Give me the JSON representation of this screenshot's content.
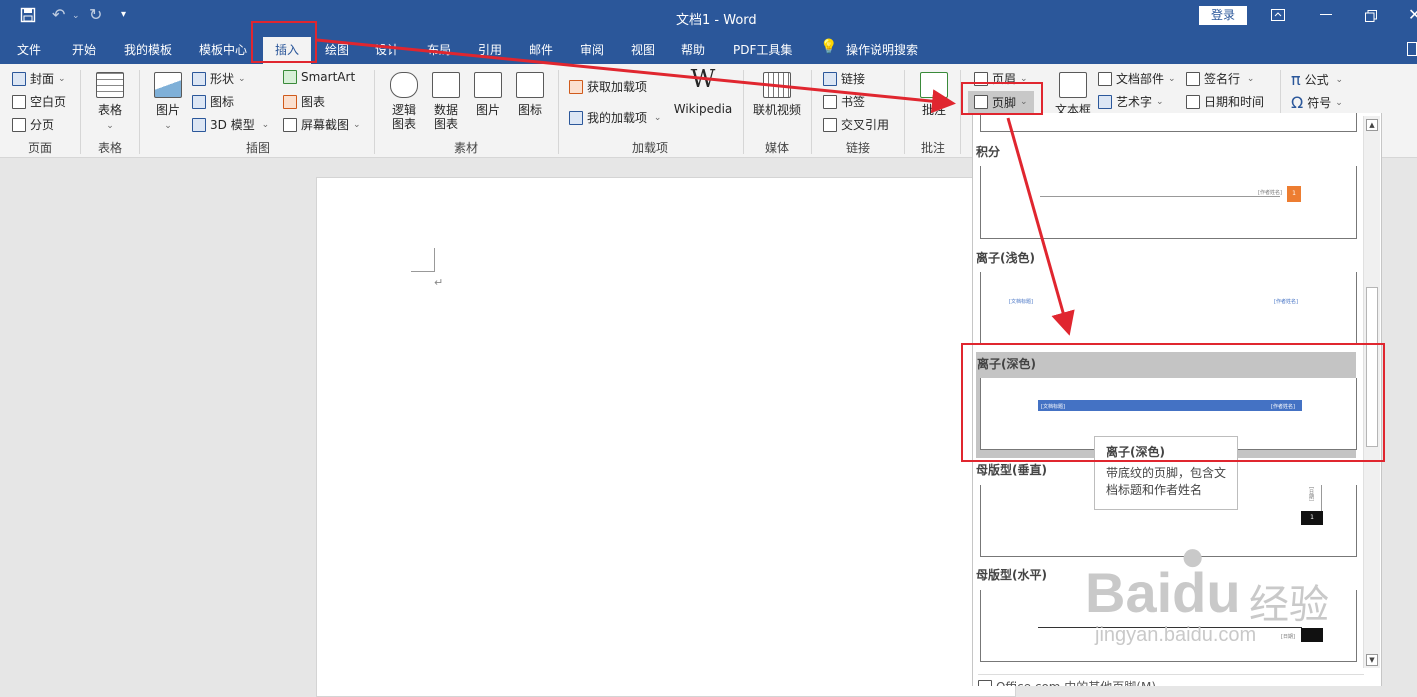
{
  "titlebar": {
    "doc_title": "文档1  -  Word",
    "login_label": "登录"
  },
  "tabs": [
    "文件",
    "开始",
    "我的模板",
    "模板中心",
    "插入",
    "绘图",
    "设计",
    "布局",
    "引用",
    "邮件",
    "审阅",
    "视图",
    "帮助",
    "PDF工具集"
  ],
  "tell_me": "操作说明搜索",
  "ribbon": {
    "pages": {
      "cover": "封面",
      "blank": "空白页",
      "break": "分页",
      "group": "页面"
    },
    "tables": {
      "table": "表格",
      "group": "表格"
    },
    "illustrations": {
      "picture": "图片",
      "shapes": "形状",
      "icons": "图标",
      "model3d": "3D 模型",
      "smartart": "SmartArt",
      "chart": "图表",
      "screenshot": "屏幕截图",
      "group": "插图"
    },
    "materials": {
      "logic1": "逻辑",
      "logic2": "图表",
      "data1": "数据",
      "data2": "图表",
      "picture": "图片",
      "icon": "图标",
      "group": "素材"
    },
    "addins": {
      "get": "获取加载项",
      "mine": "我的加载项",
      "wiki": "Wikipedia",
      "group": "加载项"
    },
    "media": {
      "video": "联机视频",
      "group": "媒体"
    },
    "links": {
      "link": "链接",
      "bookmark": "书签",
      "crossref": "交叉引用",
      "group": "链接"
    },
    "comments": {
      "comment": "批注",
      "group": "批注"
    },
    "header_footer": {
      "header": "页眉",
      "footer": "页脚"
    },
    "text": {
      "textbox": "文本框",
      "quickparts": "文档部件",
      "wordart": "艺术字",
      "signature": "签名行",
      "datetime": "日期和时间"
    },
    "symbols": {
      "equation": "公式",
      "symbol": "符号"
    }
  },
  "gallery": {
    "items": [
      {
        "title": "积分",
        "text_right": "[作者姓名]",
        "page": "1"
      },
      {
        "title": "离子(浅色)",
        "text_left": "[文档标题]",
        "text_right": "[作者姓名]"
      },
      {
        "title": "离子(深色)",
        "text_left": "[文档标题]",
        "text_right": "[作者姓名]"
      },
      {
        "title": "母版型(垂直)",
        "text_right": "[日期]",
        "page": "1"
      },
      {
        "title": "母版型(水平)",
        "text_right": "[日期]"
      }
    ],
    "more": "Office.com 中的其他页脚(M)"
  },
  "tooltip": {
    "title": "离子(深色)",
    "desc": "带底纹的页脚，包含文档标题和作者姓名"
  },
  "watermark": {
    "brand": "Baidu",
    "cn": "经验",
    "url": "jingyan.baidu.com"
  },
  "colors": {
    "accent": "#2b579a",
    "highlight": "#e0262f",
    "ion_dark": "#4472c4",
    "integral_orange": "#ed7d31"
  }
}
